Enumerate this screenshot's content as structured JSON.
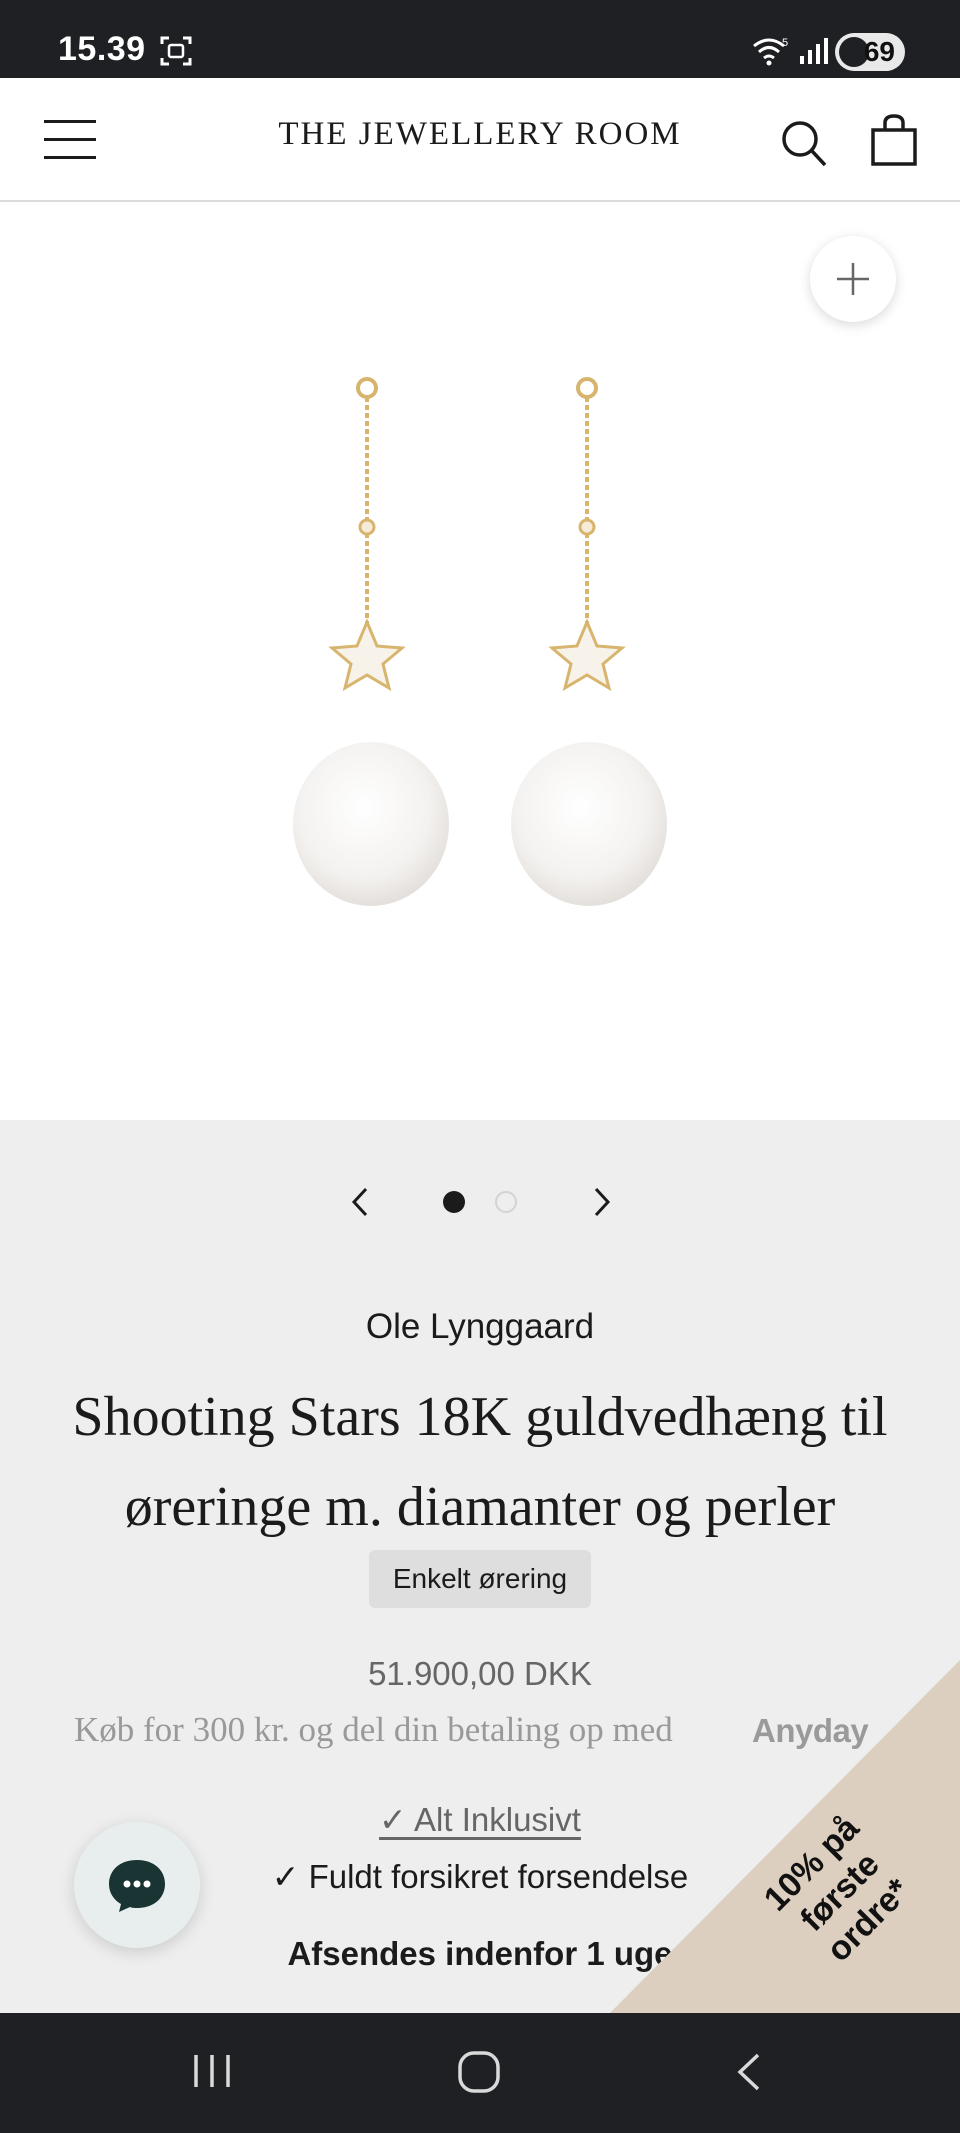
{
  "status_bar": {
    "time": "15.39",
    "battery": "69",
    "icons": [
      "screen-recorder-icon",
      "wifi-icon",
      "signal-icon",
      "battery-icon"
    ]
  },
  "header": {
    "brand": "THE JEWELLERY ROOM",
    "icons": [
      "menu-icon",
      "search-icon",
      "cart-icon"
    ]
  },
  "gallery": {
    "image_count": 2,
    "active_index": 1,
    "icons": [
      "zoom-plus-icon",
      "chevron-left-icon",
      "chevron-right-icon"
    ]
  },
  "product": {
    "brand": "Ole Lynggaard",
    "title": "Shooting Stars 18K guldvedhæng til øreringe m. diamanter og perler",
    "variant": "Enkelt ørering",
    "price": "51.900,00 DKK",
    "anyday_text": "Køb for 300 kr. og del din betaling op med",
    "anyday_logo": "Anyday",
    "included": "✓ Alt Inklusivt",
    "shipping": "✓ Fuldt forsikret forsendelse",
    "dispatch": "Afsendes indenfor 1 uge"
  },
  "promo": {
    "text": "10% på første ordre*",
    "color": "#dccfbf"
  },
  "chat": {
    "icon": "chat-bubble-icon"
  },
  "nav_bar": {
    "icons": [
      "recent-apps-icon",
      "home-icon",
      "back-icon"
    ]
  }
}
